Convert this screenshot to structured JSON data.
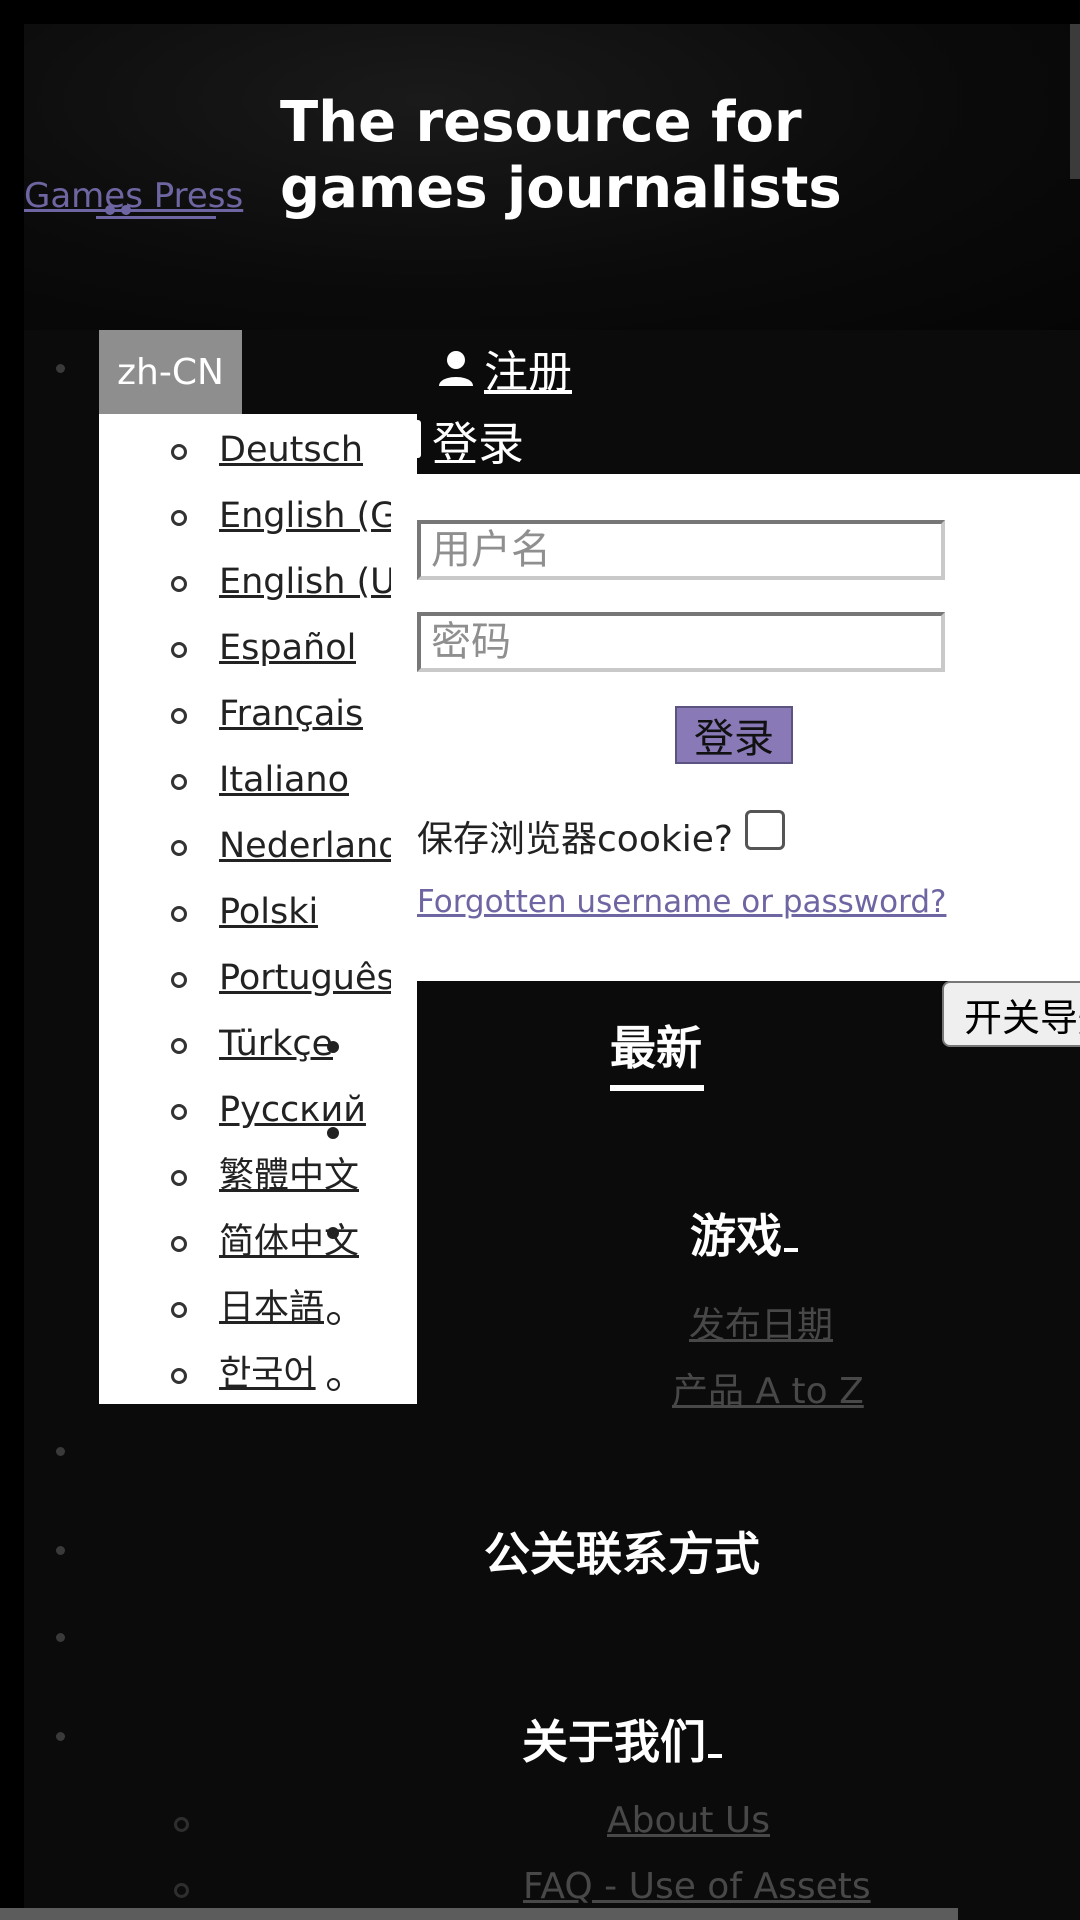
{
  "header": {
    "logo_text": "Games Press",
    "tagline_line1": "The resource for",
    "tagline_line2": "games journalists"
  },
  "language": {
    "current": "zh-CN",
    "options": [
      "Deutsch",
      "English (GB)",
      "English (US)",
      "Español",
      "Français",
      "Italiano",
      "Nederlands",
      "Polski",
      "Português",
      "Türkçe",
      "Русский",
      "繁體中文",
      "简体中文",
      "日本語",
      "한국어"
    ]
  },
  "auth": {
    "register_label": "注册",
    "login_toggle_label": "登录",
    "username_placeholder": "用户名",
    "password_placeholder": "密码",
    "submit_label": "登录",
    "remember_label": "保存浏览器cookie?",
    "forgot_label": "Forgotten username or password?"
  },
  "nav_toggle_label": "开关导航",
  "nav": {
    "latest": "最新",
    "games": "游戏",
    "games_sub": [
      "发布日期",
      "产品 A to Z"
    ],
    "pr_contacts": "公关联系方式",
    "about": "关于我们",
    "about_sub": [
      "About Us",
      "FAQ - Use of Assets"
    ]
  },
  "colors": {
    "accent": "#8979b6",
    "link": "#6e66a2",
    "background": "#0b0b0b"
  }
}
